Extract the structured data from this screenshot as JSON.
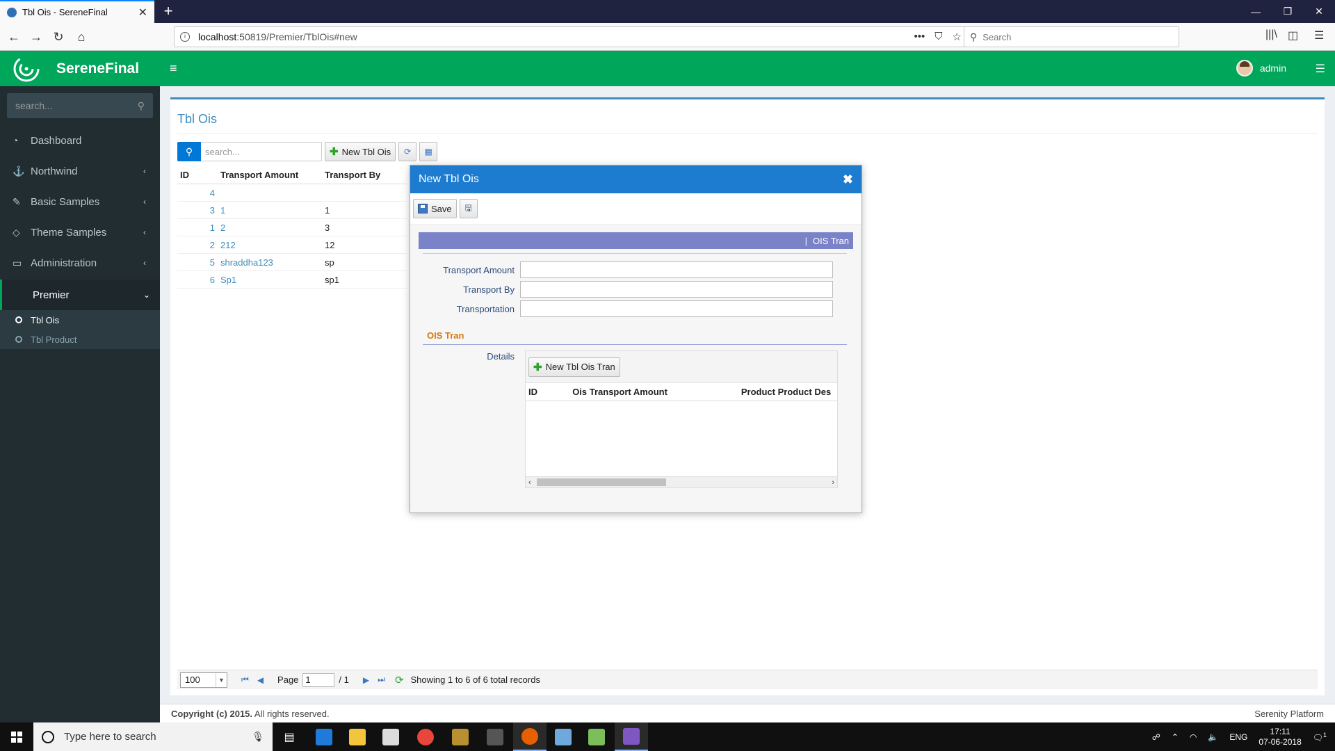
{
  "browser": {
    "tab_title": "Tbl Ois - SereneFinal",
    "url_host": "localhost",
    "url_path": ":50819/Premier/TblOis#new",
    "search_placeholder": "Search"
  },
  "app": {
    "name": "SereneFinal",
    "user": "admin"
  },
  "sidebar": {
    "search_placeholder": "search...",
    "items": [
      {
        "label": "Dashboard",
        "icon": "dashboard-icon"
      },
      {
        "label": "Northwind",
        "icon": "anchor-icon"
      },
      {
        "label": "Basic Samples",
        "icon": "magic-wand-icon"
      },
      {
        "label": "Theme Samples",
        "icon": "diamond-icon"
      },
      {
        "label": "Administration",
        "icon": "desktop-icon"
      },
      {
        "label": "Premier",
        "icon": ""
      }
    ],
    "submenu": [
      {
        "label": "Tbl Ois"
      },
      {
        "label": "Tbl Product"
      }
    ]
  },
  "page": {
    "title": "Tbl Ois",
    "quick_search_placeholder": "search...",
    "new_button": "New Tbl Ois"
  },
  "grid": {
    "columns": [
      "ID",
      "Transport Amount",
      "Transport By"
    ],
    "rows": [
      {
        "id": "4",
        "amount": "",
        "by": ""
      },
      {
        "id": "3",
        "amount": "1",
        "by": "1"
      },
      {
        "id": "1",
        "amount": "2",
        "by": "3"
      },
      {
        "id": "2",
        "amount": "212",
        "by": "12"
      },
      {
        "id": "5",
        "amount": "shraddha123",
        "by": "sp"
      },
      {
        "id": "6",
        "amount": "Sp1",
        "by": "sp1"
      }
    ]
  },
  "pager": {
    "page_size": "100",
    "page_label": "Page",
    "current_page": "1",
    "total_pages": "/ 1",
    "status": "Showing 1 to 6 of 6 total records"
  },
  "footer": {
    "copyright": "Copyright (c) 2015.",
    "rights": " All rights reserved.",
    "platform": "Serenity Platform"
  },
  "dialog": {
    "title": "New Tbl Ois",
    "save_label": "Save",
    "category_link": "OIS Tran",
    "fields": [
      {
        "label": "Transport Amount",
        "value": ""
      },
      {
        "label": "Transport By",
        "value": ""
      },
      {
        "label": "Transportation",
        "value": ""
      }
    ],
    "category_title": "OIS Tran",
    "details_label": "Details",
    "detail_new_button": "New Tbl Ois Tran",
    "detail_columns": [
      "ID",
      "Ois Transport Amount",
      "Product Product Des"
    ]
  },
  "taskbar": {
    "search_placeholder": "Type here to search",
    "language": "ENG",
    "time": "17:11",
    "date": "07-06-2018",
    "notification_count": "1"
  }
}
